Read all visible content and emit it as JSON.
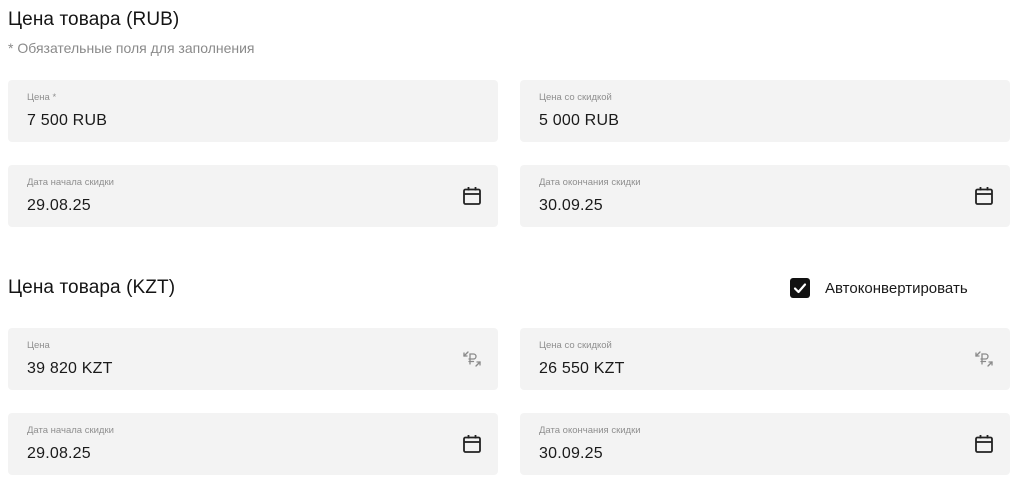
{
  "rub_section": {
    "title": "Цена товара (RUB)",
    "required_note": "* Обязательные поля для заполнения",
    "price": {
      "label": "Цена *",
      "value": "7 500 RUB"
    },
    "discount_price": {
      "label": "Цена со скидкой",
      "value": "5 000 RUB"
    },
    "discount_start": {
      "label": "Дата начала скидки",
      "value": "29.08.25",
      "icon": "calendar-icon"
    },
    "discount_end": {
      "label": "Дата окончания скидки",
      "value": "30.09.25",
      "icon": "calendar-icon"
    }
  },
  "kzt_section": {
    "title": "Цена товара (KZT)",
    "autoconvert": {
      "label": "Автоконвертировать",
      "checked": true
    },
    "price": {
      "label": "Цена",
      "value": "39 820 KZT",
      "icon": "currency-convert-icon"
    },
    "discount_price": {
      "label": "Цена со скидкой",
      "value": "26 550 KZT",
      "icon": "currency-convert-icon"
    },
    "discount_start": {
      "label": "Дата начала скидки",
      "value": "29.08.25",
      "icon": "calendar-icon"
    },
    "discount_end": {
      "label": "Дата окончания скидки",
      "value": "30.09.25",
      "icon": "calendar-icon"
    }
  },
  "colors": {
    "field_bg": "#f3f3f3",
    "label": "#8f8f8f",
    "text": "#1a1a1a",
    "checkbox": "#111111"
  }
}
